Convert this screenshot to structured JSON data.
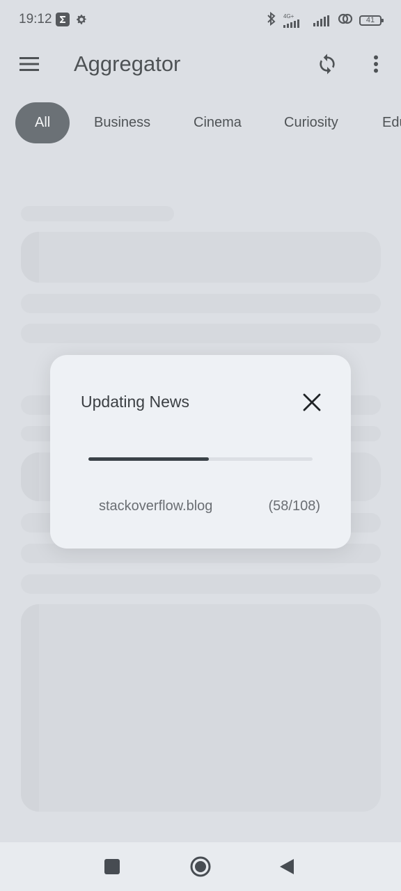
{
  "status_bar": {
    "time": "19:12",
    "network": "4G+",
    "battery": "41"
  },
  "app_bar": {
    "title": "Aggregator"
  },
  "tabs": [
    {
      "label": "All",
      "active": true
    },
    {
      "label": "Business",
      "active": false
    },
    {
      "label": "Cinema",
      "active": false
    },
    {
      "label": "Curiosity",
      "active": false
    },
    {
      "label": "Edu",
      "active": false
    }
  ],
  "dialog": {
    "title": "Updating News",
    "progress_fraction": 0.537,
    "source": "stackoverflow.blog",
    "count": "(58/108)"
  },
  "colors": {
    "background": "#dcdfe4",
    "active_tab": "#464c52",
    "progress": "#3b4248"
  },
  "icons": {
    "menu": "hamburger-icon",
    "refresh": "refresh-icon",
    "more": "more-vert-icon",
    "close": "close-icon",
    "nav_recents": "square-icon",
    "nav_home": "circle-icon",
    "nav_back": "triangle-back-icon"
  }
}
